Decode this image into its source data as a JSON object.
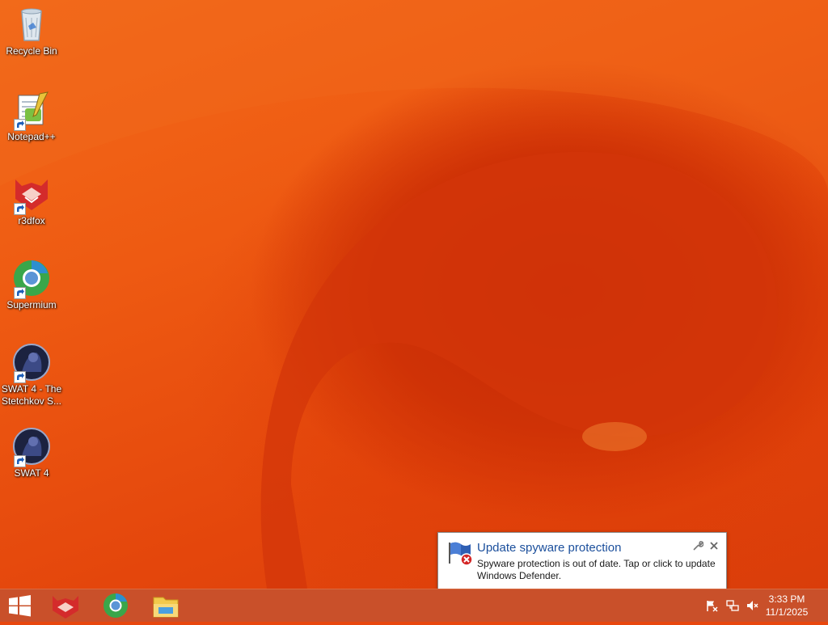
{
  "desktop": {
    "icons": [
      {
        "name": "recycle-bin",
        "label": "Recycle Bin"
      },
      {
        "name": "notepad-plus-plus",
        "label": "Notepad++"
      },
      {
        "name": "r3dfox",
        "label": "r3dfox"
      },
      {
        "name": "supermium",
        "label": "Supermium"
      },
      {
        "name": "swat4-stetchkov",
        "label": "SWAT 4 - The Stetchkov S..."
      },
      {
        "name": "swat4",
        "label": "SWAT 4"
      }
    ]
  },
  "notification": {
    "title": "Update spyware protection",
    "body": "Spyware protection is out of date. Tap or click to update Windows Defender.",
    "icon": "windows-defender-flag-error-icon"
  },
  "taskbar": {
    "start_icon": "windows-logo-icon",
    "pinned": [
      "r3dfox-icon",
      "supermium-icon",
      "file-explorer-icon"
    ],
    "tray": [
      "action-center-flag-icon",
      "network-icon",
      "volume-muted-icon"
    ],
    "clock": {
      "time": "3:33 PM",
      "date": "11/1/2025"
    }
  },
  "colors": {
    "wallpaper": "#e8470e",
    "taskbar": "#c9502a",
    "toast_title": "#1b4f9c"
  }
}
